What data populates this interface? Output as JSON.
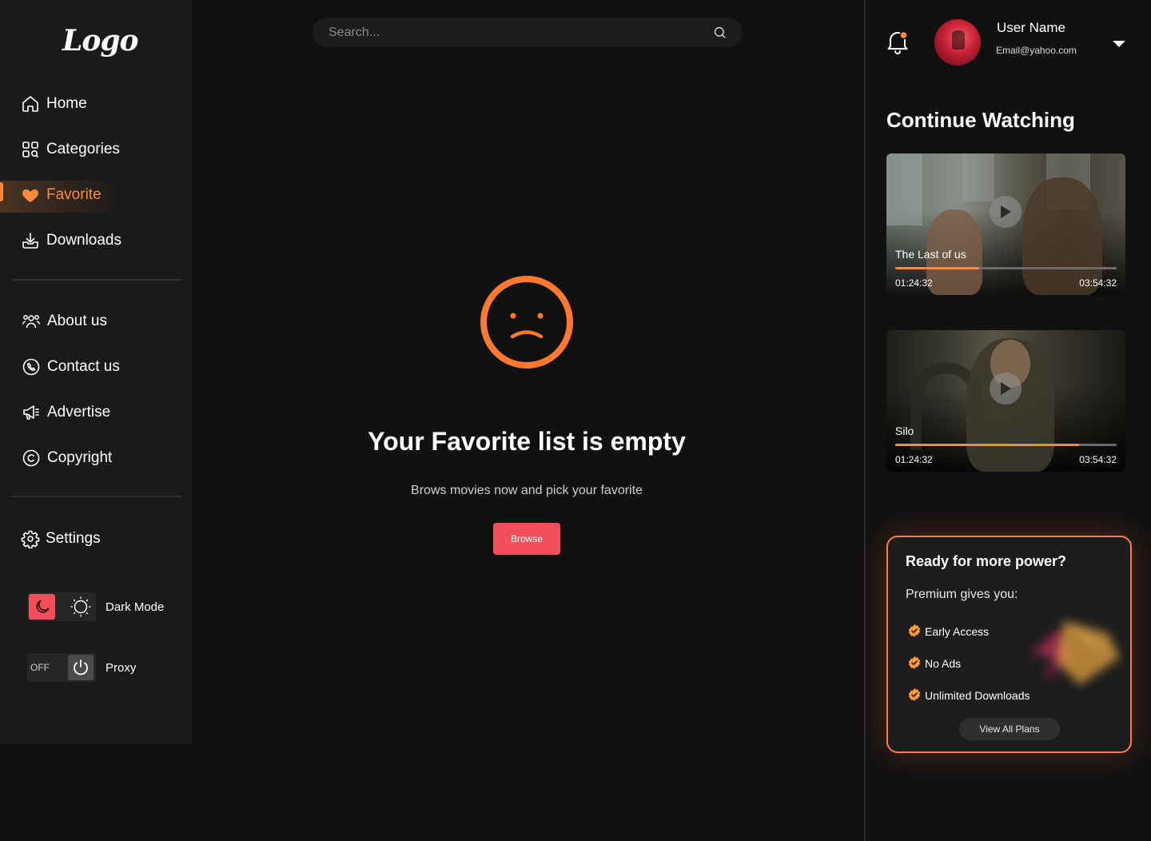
{
  "brand": {
    "logo_text": "Logo"
  },
  "sidebar": {
    "primary_nav": [
      {
        "label": "Home",
        "icon": "home-icon"
      },
      {
        "label": "Categories",
        "icon": "categories-icon"
      },
      {
        "label": "Favorite",
        "icon": "heart-icon",
        "active": true
      },
      {
        "label": "Downloads",
        "icon": "download-icon"
      }
    ],
    "secondary_nav": [
      {
        "label": "About us",
        "icon": "users-icon"
      },
      {
        "label": "Contact us",
        "icon": "phone-icon"
      },
      {
        "label": "Advertise",
        "icon": "megaphone-icon"
      },
      {
        "label": "Copyright",
        "icon": "copyright-icon"
      }
    ],
    "settings": {
      "label": "Settings",
      "icon": "gear-icon"
    },
    "dark_mode": {
      "label": "Dark Mode",
      "enabled": true
    },
    "proxy": {
      "label": "Proxy",
      "state_label": "OFF"
    }
  },
  "search": {
    "placeholder": "Search..."
  },
  "empty_state": {
    "title": "Your Favorite list is empty",
    "subtitle": "Brows movies now and pick your favorite",
    "button_label": "Browse"
  },
  "user": {
    "name": "User Name",
    "email": "Email@yahoo.com",
    "has_notification": true
  },
  "continue_watching": {
    "title": "Continue Watching",
    "items": [
      {
        "title": "The Last of us",
        "current": "01:24:32",
        "duration": "03:54:32",
        "progress_percent": 38
      },
      {
        "title": "Silo",
        "current": "01:24:32",
        "duration": "03:54:32",
        "progress_percent": 83
      }
    ]
  },
  "premium": {
    "title": "Ready for more power?",
    "subtitle": "Premium gives you:",
    "features": [
      "Early Access",
      "No Ads",
      "Unlimited Downloads"
    ],
    "button_label": "View All Plans"
  },
  "colors": {
    "accent": "#ff8a3d",
    "primary_button": "#f24f5a",
    "background": "#111111",
    "sidebar": "#1a1a1a"
  }
}
